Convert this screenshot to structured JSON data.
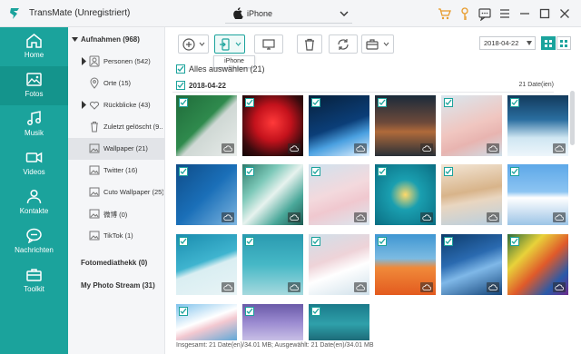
{
  "app": {
    "title": "TransMate (Unregistriert)",
    "device": "iPhone"
  },
  "sidebar": {
    "items": [
      {
        "label": "Home",
        "icon": "home-icon"
      },
      {
        "label": "Fotos",
        "icon": "photos-icon",
        "active": true
      },
      {
        "label": "Musik",
        "icon": "music-icon"
      },
      {
        "label": "Videos",
        "icon": "video-icon"
      },
      {
        "label": "Kontakte",
        "icon": "contacts-icon"
      },
      {
        "label": "Nachrichten",
        "icon": "messages-icon"
      },
      {
        "label": "Toolkit",
        "icon": "toolbox-icon"
      }
    ]
  },
  "tree": {
    "root": "Aufnahmen (968)",
    "items": [
      {
        "label": "Personen (542)",
        "icon": "person-icon"
      },
      {
        "label": "Orte (15)",
        "icon": "location-icon"
      },
      {
        "label": "Rückblicke (43)",
        "icon": "memories-icon"
      },
      {
        "label": "Zuletzt gelöscht (9...",
        "icon": "trash-icon"
      },
      {
        "label": "Wallpaper (21)",
        "icon": "album-icon"
      },
      {
        "label": "Twitter (16)",
        "icon": "album-icon"
      },
      {
        "label": "Cuto Wallpaper (25)",
        "icon": "album-icon"
      },
      {
        "label": "微博 (0)",
        "icon": "album-icon"
      },
      {
        "label": "TikTok (1)",
        "icon": "album-icon"
      }
    ],
    "library": "Fotomediathekk (0)",
    "stream": "My Photo Stream (31)"
  },
  "toolbar": {
    "tooltip": "iPhone",
    "date_filter": "2018-04-22"
  },
  "content": {
    "select_all": "Alles auswählen (21)",
    "group_date": "2018-04-22",
    "group_count": "21 Date(ien)",
    "status": "Insgesamt: 21 Date(en)/34.01 MB; Ausgewählt: 21 Date(en)/34.01 MB"
  },
  "colors": {
    "accent": "#1ba39c",
    "accent_dark": "#14948c"
  }
}
